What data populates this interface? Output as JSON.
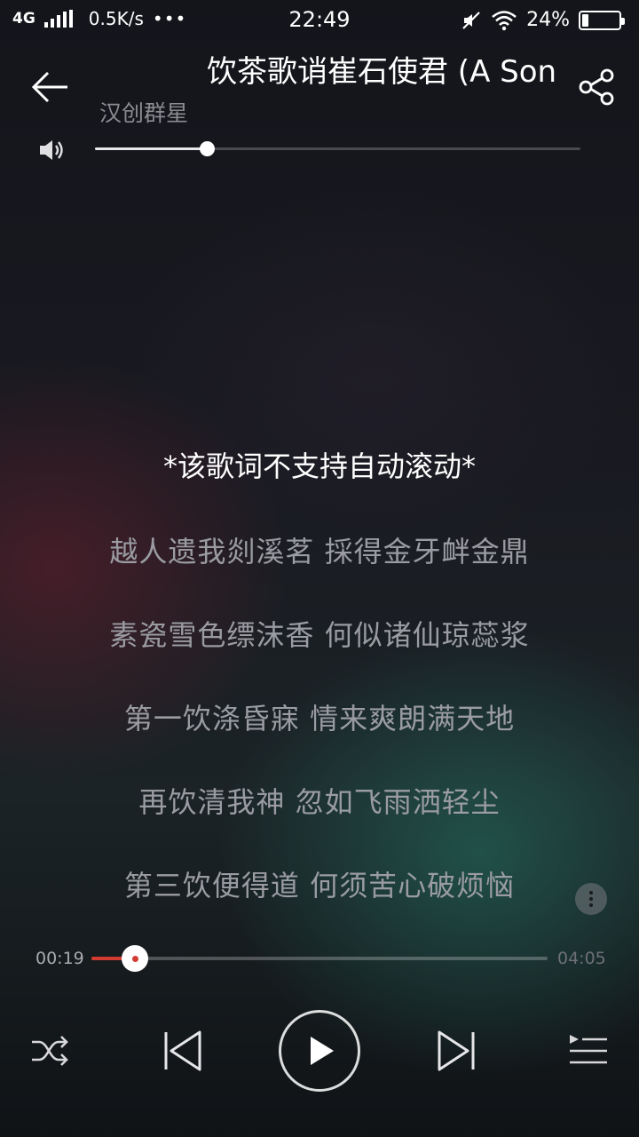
{
  "status_bar": {
    "network": "4G",
    "speed": "0.5K/s",
    "dots": "•••",
    "time": "22:49",
    "battery": "24%",
    "battery_level": 0.24
  },
  "header": {
    "title": "饮茶歌诮崔石使君 (A Song of Tea)",
    "artist": "汉创群星"
  },
  "volume": {
    "level": 0.23
  },
  "lyrics": {
    "notice": "*该歌词不支持自动滚动*",
    "lines": [
      "越人遗我剡溪茗 採得金牙衅金鼎",
      "素瓷雪色缥沫香 何似诸仙琼蕊浆",
      "第一饮涤昏寐 情来爽朗满天地",
      "再饮清我神 忽如飞雨洒轻尘",
      "第三饮便得道 何须苦心破烦恼"
    ]
  },
  "progress": {
    "current": "00:19",
    "total": "04:05",
    "fraction": 0.0957
  },
  "icons": {
    "back": "arrow-left-icon",
    "share": "share-icon",
    "volume": "speaker-icon",
    "more": "more-vertical-icon",
    "shuffle": "shuffle-icon",
    "prev": "skip-previous-icon",
    "play": "play-icon",
    "next": "skip-next-icon",
    "playlist": "playlist-icon"
  },
  "colors": {
    "accent": "#d33a32",
    "lyric_dim": "#9a9ca2",
    "artist": "#8a8c92"
  }
}
